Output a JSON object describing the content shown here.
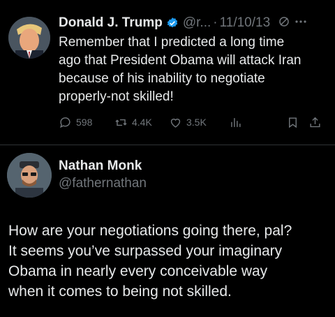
{
  "tweet": {
    "author_name": "Donald J. Trump",
    "handle": "@r...",
    "separator": "·",
    "date": "11/10/13",
    "text_lines": [
      "Remember that I predicted a long time",
      "ago that President Obama will attack Iran",
      "because of his inability to negotiate",
      "properly-not skilled!"
    ],
    "verified_icon": "verified-badge-icon",
    "header_icons": [
      "grok-icon",
      "more-icon"
    ],
    "actions": {
      "replies": "598",
      "reposts": "4.4K",
      "likes": "3.5K"
    },
    "action_icons": [
      "reply-icon",
      "repost-icon",
      "like-icon",
      "views-icon",
      "bookmark-icon",
      "share-icon"
    ]
  },
  "reply": {
    "author_name": "Nathan Monk",
    "handle": "@fathernathan",
    "text_lines": [
      "How are your negotiations going there, pal?",
      "It seems you’ve surpassed your imaginary",
      "Obama in nearly every conceivable way",
      "when it comes to being not skilled."
    ]
  },
  "colors": {
    "background": "#000000",
    "text_primary": "#e7e9ea",
    "text_secondary": "#71767b",
    "verified": "#1d9bf0",
    "divider": "#2f3336"
  }
}
